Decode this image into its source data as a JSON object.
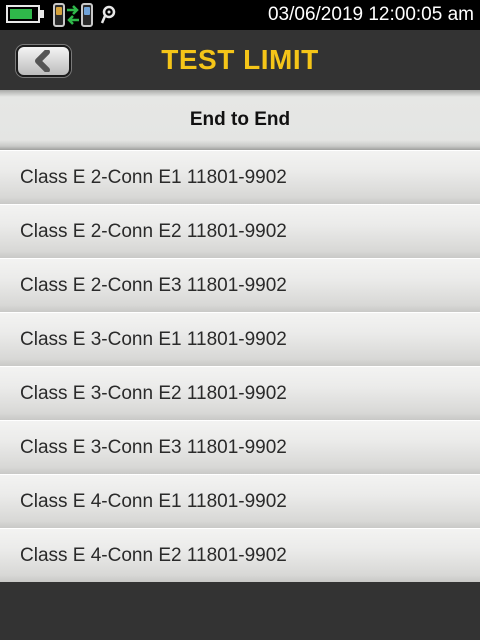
{
  "status_bar": {
    "battery_level": 0.85,
    "battery_color": "#2fb84a",
    "datetime": "03/06/2019  12:00:05 am",
    "icons": [
      "battery-icon",
      "main-unit-icon",
      "link-arrows-icon",
      "remote-unit-icon",
      "probe-icon"
    ]
  },
  "header": {
    "title": "TEST LIMIT",
    "title_color": "#f5c518",
    "back_icon": "chevron-left-icon"
  },
  "section": {
    "label": "End to End"
  },
  "limits": [
    {
      "label": "Class E 2-Conn E1 11801-9902"
    },
    {
      "label": "Class E 2-Conn E2 11801-9902"
    },
    {
      "label": "Class E 2-Conn E3 11801-9902"
    },
    {
      "label": "Class E 3-Conn E1 11801-9902"
    },
    {
      "label": "Class E 3-Conn E2 11801-9902"
    },
    {
      "label": "Class E 3-Conn E3 11801-9902"
    },
    {
      "label": "Class E 4-Conn E1 11801-9902"
    },
    {
      "label": "Class E 4-Conn E2 11801-9902"
    }
  ]
}
